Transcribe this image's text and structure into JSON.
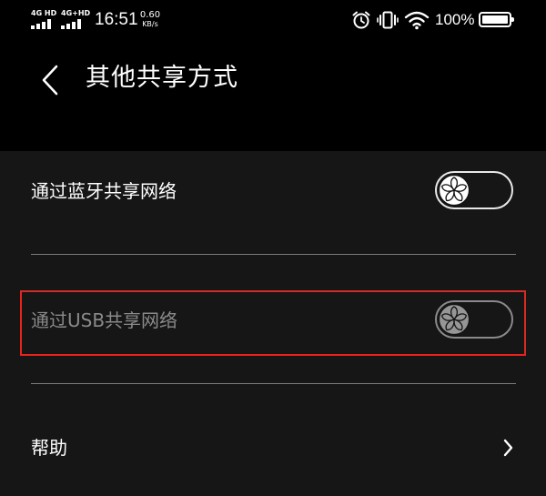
{
  "status_bar": {
    "network_1": "4G HD",
    "network_2": "4G+HD",
    "time": "16:51",
    "speed_value": "0.60",
    "speed_unit": "KB/s",
    "battery": "100%",
    "icons": [
      "alarm-icon",
      "vibrate-icon",
      "wifi-icon",
      "battery-icon"
    ]
  },
  "header": {
    "title": "其他共享方式",
    "back_icon": "chevron-left-icon"
  },
  "settings": {
    "bluetooth": {
      "label": "通过蓝牙共享网络",
      "enabled": false
    },
    "usb": {
      "label": "通过USB共享网络",
      "enabled": false,
      "disabled": true,
      "highlighted": true
    },
    "help": {
      "label": "帮助",
      "chevron_icon": "chevron-right-icon"
    }
  },
  "colors": {
    "background": "#000000",
    "row_background": "#161616",
    "text": "#ffffff",
    "disabled_text": "#8a8a8a",
    "highlight": "#e0261e",
    "divider": "#7a7a7a"
  }
}
